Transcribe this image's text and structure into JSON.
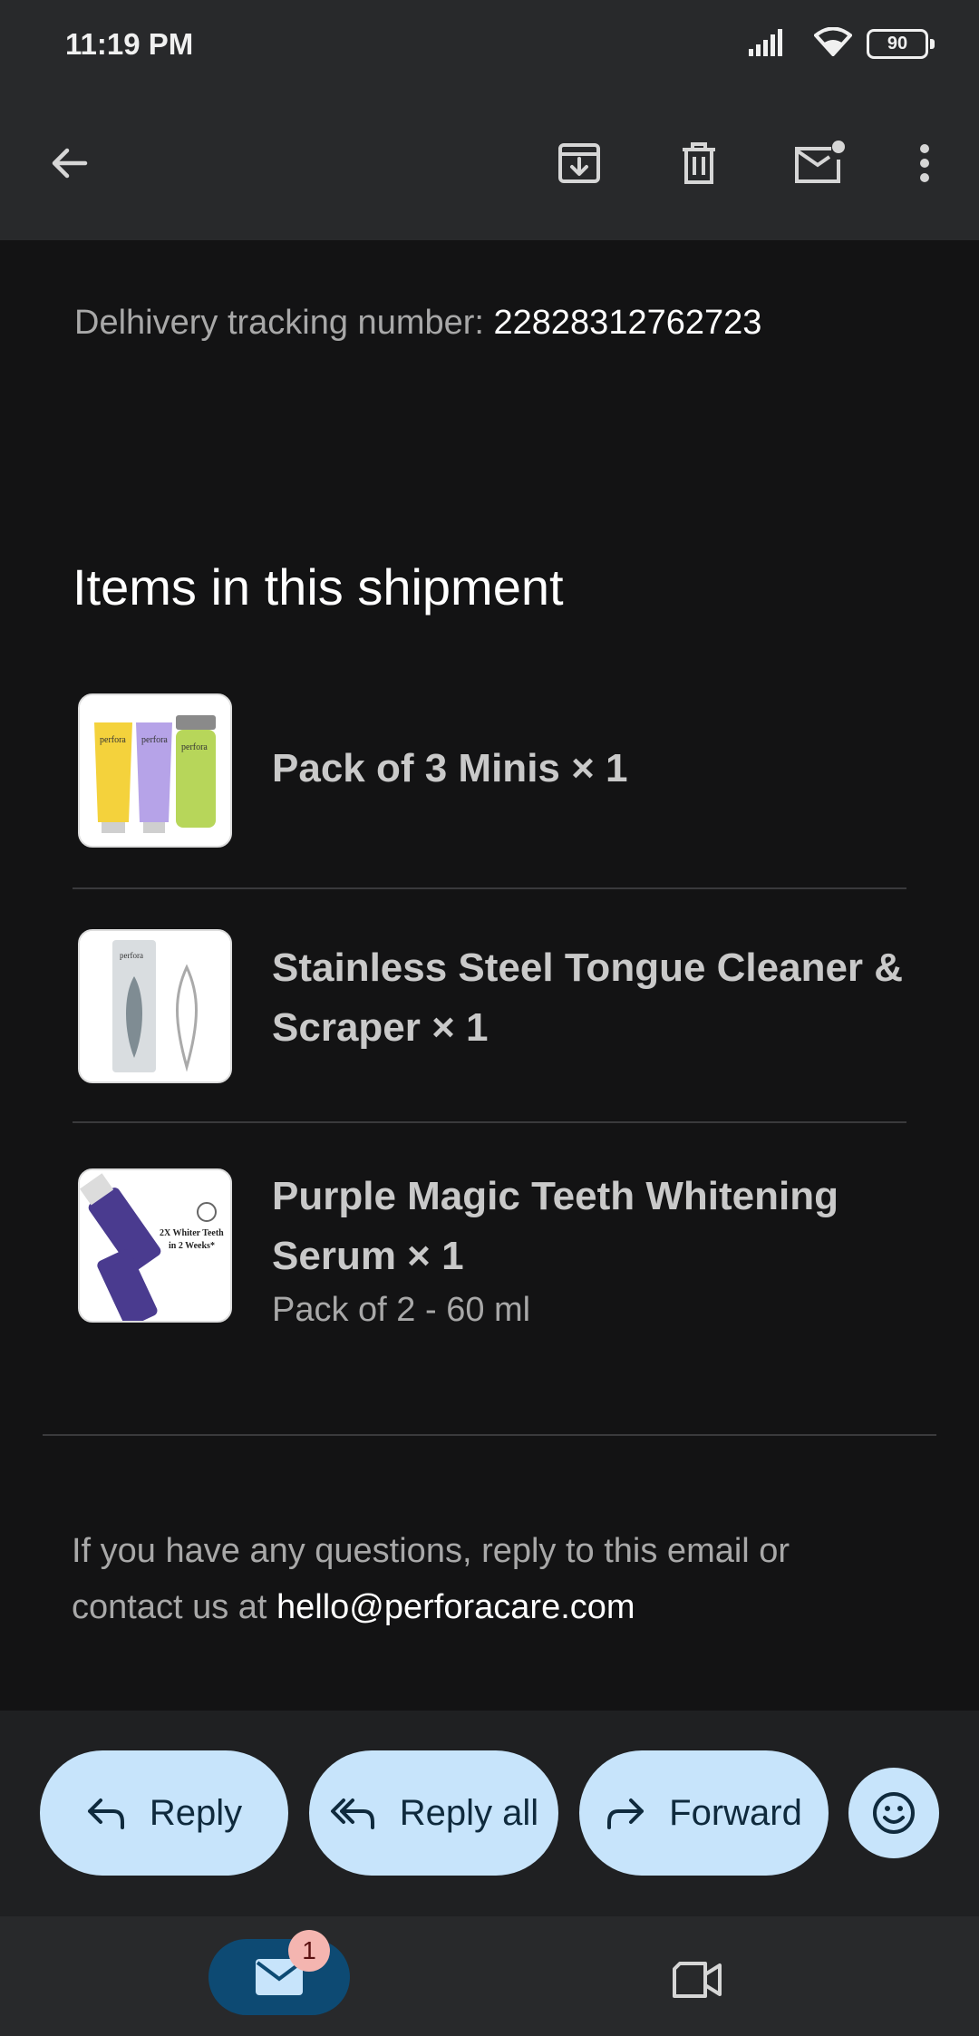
{
  "status_bar": {
    "time": "11:19 PM",
    "battery": "90",
    "icons": [
      "signal-icon",
      "wifi-icon",
      "battery-icon"
    ]
  },
  "toolbar": {
    "icons": [
      "back-arrow-icon",
      "archive-icon",
      "delete-icon",
      "mark-unread-icon",
      "more-vert-icon"
    ]
  },
  "email": {
    "tracking_label": "Delhivery tracking number: ",
    "tracking_number": "22828312762723",
    "items_title": "Items in this shipment",
    "items": [
      {
        "title": "Pack of 3 Minis × 1",
        "subtitle": ""
      },
      {
        "title": "Stainless Steel Tongue Cleaner & Scraper × 1",
        "subtitle": ""
      },
      {
        "title": "Purple Magic Teeth Whitening Serum × 1",
        "subtitle": "Pack of 2 - 60 ml"
      }
    ],
    "thumb_texts": {
      "brand": "perfora",
      "serum_line1": "2X Whiter Teeth",
      "serum_line2": "in 2 Weeks*"
    },
    "contact_text": "If you have any questions, reply to this email or contact us at ",
    "contact_email": "hello@perforacare.com"
  },
  "actions": {
    "reply": "Reply",
    "reply_all": "Reply all",
    "forward": "Forward"
  },
  "bottom_nav": {
    "mail_badge": "1",
    "accent": "#0d4a73"
  }
}
